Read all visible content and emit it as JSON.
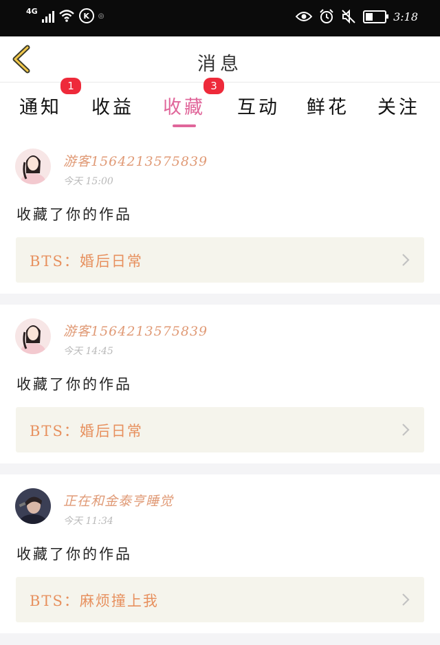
{
  "status_bar": {
    "network": "4G",
    "carrier_icon": "K",
    "time": "3:18",
    "battery_level": 0.4
  },
  "header": {
    "title": "消息",
    "back_icon": "chevron-left-icon"
  },
  "tabs": [
    {
      "label": "通知",
      "badge": "1"
    },
    {
      "label": "收益",
      "badge": ""
    },
    {
      "label": "收藏",
      "badge": "3",
      "active": true
    },
    {
      "label": "互动",
      "badge": ""
    },
    {
      "label": "鲜花",
      "badge": ""
    },
    {
      "label": "关注",
      "badge": ""
    }
  ],
  "messages": [
    {
      "user": "游客1564213575839",
      "time": "今天 15:00",
      "action": "收藏了你的作品",
      "work_title": "BTS：婚后日常"
    },
    {
      "user": "游客1564213575839",
      "time": "今天 14:45",
      "action": "收藏了你的作品",
      "work_title": "BTS：婚后日常"
    },
    {
      "user": "正在和金泰亨睡觉",
      "time": "今天 11:34",
      "action": "收藏了你的作品",
      "work_title": "BTS：麻烦撞上我"
    }
  ],
  "colors": {
    "accent": "#e0669a",
    "badge": "#ee2a3a",
    "username": "#e09a76",
    "work_title": "#e7905e",
    "work_bg": "#f5f4ec"
  }
}
